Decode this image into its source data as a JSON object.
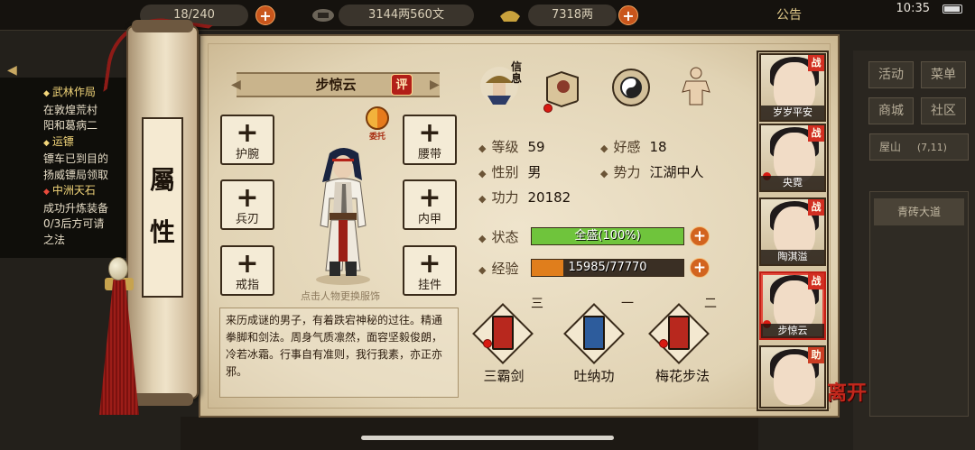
{
  "topbar": {
    "stamina": "18/240",
    "money": "3144两560文",
    "ingot": "7318两",
    "notice": "公告",
    "time": "10:35"
  },
  "log": {
    "items": [
      {
        "title": "武林作局",
        "text1": "在敦煌荒村",
        "text2": "阳和葛病二"
      },
      {
        "title": "运镖",
        "text1": "镖车已到目的",
        "text2": "扬威镖局领取"
      },
      {
        "title": "中洲天石",
        "text1": "成功升炼装备",
        "text2": "0/3后方可请",
        "text3": "之法"
      }
    ]
  },
  "scroll": {
    "label_top": "屬",
    "label_bottom": "性"
  },
  "character": {
    "name": "步惊云",
    "rate_button": "评",
    "entrust": "委托",
    "change_hint": "点击人物更换服饰",
    "description": "来历成谜的男子，有着跌宕神秘的过往。精通拳脚和剑法。周身气质凛然，面容坚毅俊朗，冷若冰霜。行事自有准则，我行我素，亦正亦邪。"
  },
  "equipment": {
    "left": [
      "护腕",
      "兵刃",
      "戒指"
    ],
    "right": [
      "腰带",
      "内甲",
      "挂件"
    ],
    "plus": "+"
  },
  "tabs": {
    "info_label": "信息"
  },
  "stats": {
    "level_label": "等级",
    "level": "59",
    "favor_label": "好感",
    "favor": "18",
    "gender_label": "性别",
    "gender": "男",
    "faction_label": "势力",
    "faction": "江湖中人",
    "power_label": "功力",
    "power": "20182",
    "status_label": "状态",
    "status_text": "全盛(100%)",
    "status_pct": 100,
    "exp_label": "经验",
    "exp_text": "15985/77770",
    "exp_pct": 20.6
  },
  "skills": [
    {
      "level": "三",
      "name": "三霸剑",
      "color": "#b8281e"
    },
    {
      "level": "一",
      "name": "吐纳功",
      "color": "#2d5c9c"
    },
    {
      "level": "二",
      "name": "梅花步法",
      "color": "#b8281e"
    }
  ],
  "party": [
    {
      "name": "岁岁平安",
      "role": "战"
    },
    {
      "name": "央霓",
      "role": "战"
    },
    {
      "name": "陶淇溢",
      "role": "战"
    },
    {
      "name": "步惊云",
      "role": "战"
    },
    {
      "name": "",
      "role": "助"
    }
  ],
  "leave": "离开",
  "side": {
    "activity": "活动",
    "menu": "菜单",
    "shop": "商城",
    "community": "社区",
    "location": "屋山",
    "coords": "(7,11)",
    "road": "青砖大道"
  },
  "colors": {
    "status_fill": "#6fc43c",
    "exp_fill": "#e07e1c",
    "accent": "#c9561c"
  }
}
